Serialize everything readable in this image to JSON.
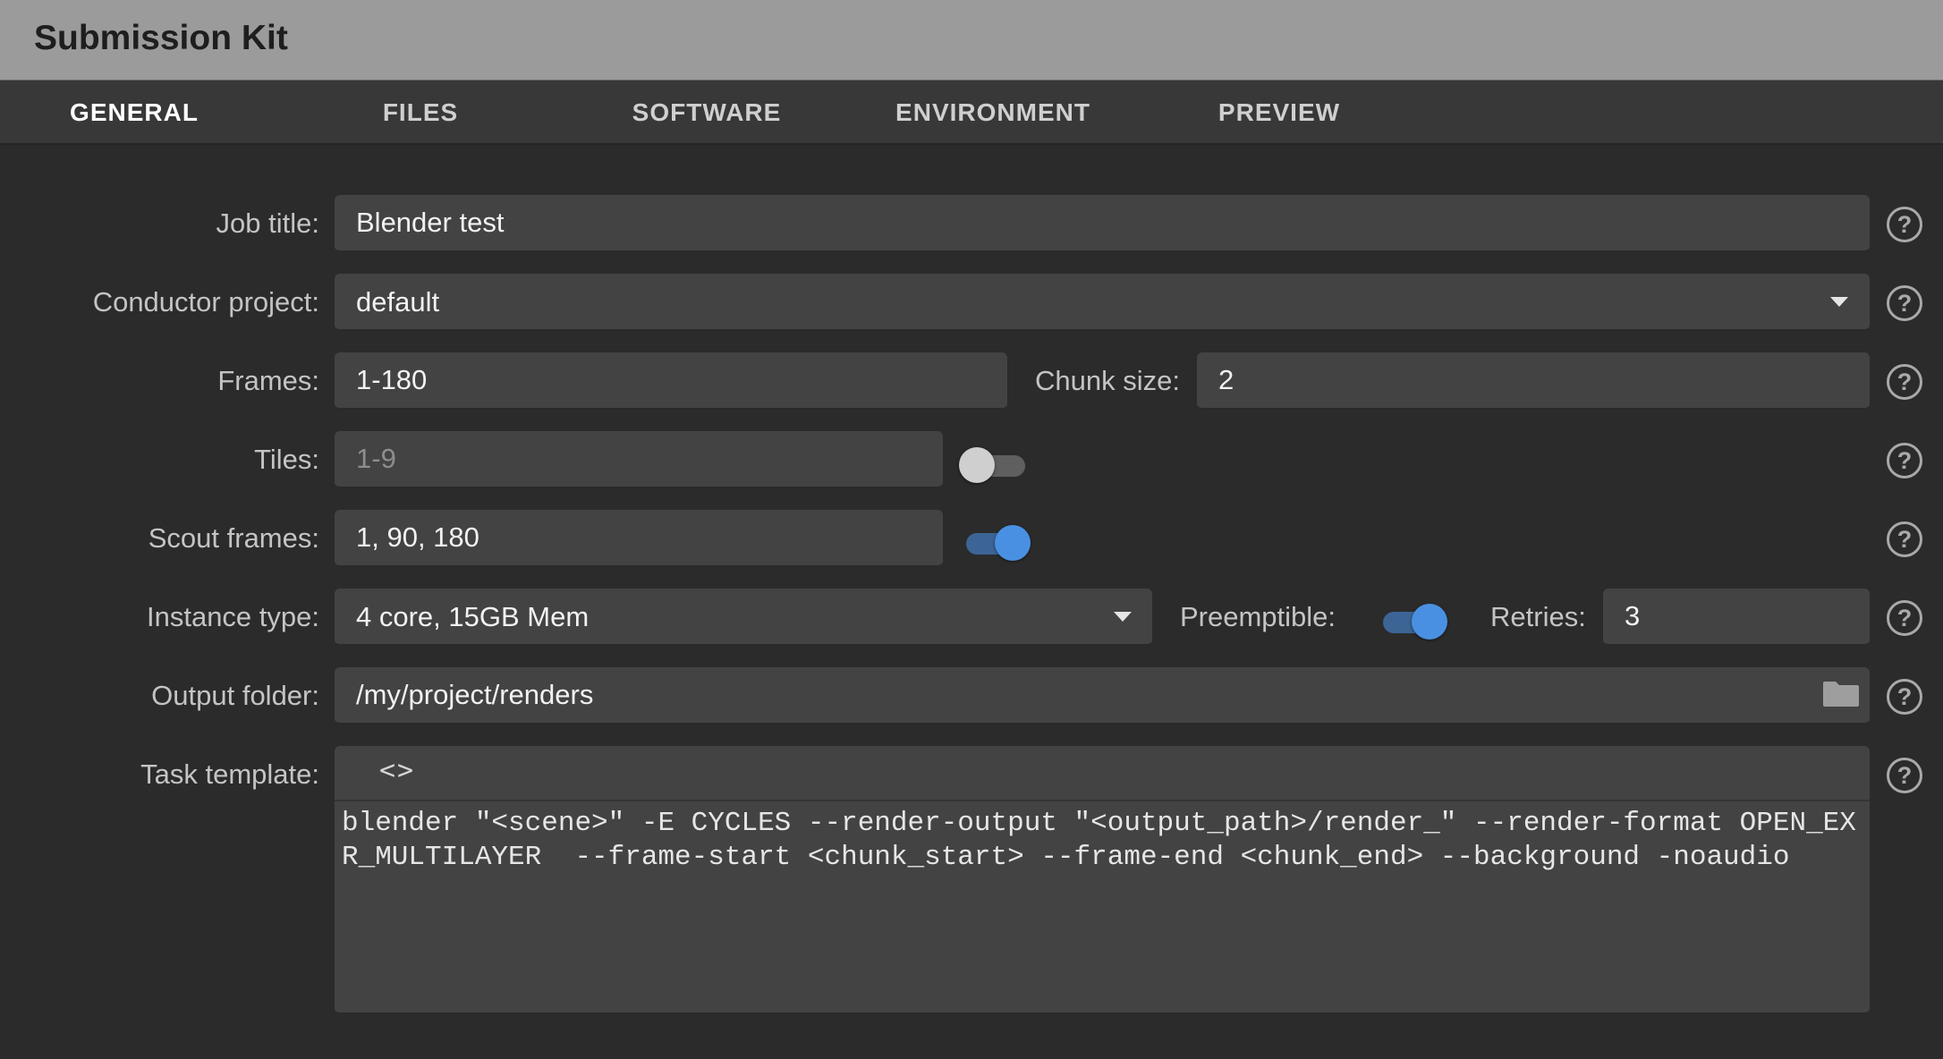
{
  "app": {
    "title": "Submission Kit"
  },
  "tabs": [
    {
      "label": "GENERAL",
      "active": true
    },
    {
      "label": "FILES",
      "active": false
    },
    {
      "label": "SOFTWARE",
      "active": false
    },
    {
      "label": "ENVIRONMENT",
      "active": false
    },
    {
      "label": "PREVIEW",
      "active": false
    }
  ],
  "form": {
    "job_title": {
      "label": "Job title:",
      "value": "Blender test"
    },
    "conductor_project": {
      "label": "Conductor project:",
      "value": "default"
    },
    "frames": {
      "label": "Frames:",
      "value": "1-180"
    },
    "chunk_size": {
      "label": "Chunk size:",
      "value": "2"
    },
    "tiles": {
      "label": "Tiles:",
      "placeholder": "1-9",
      "enabled": false
    },
    "scout_frames": {
      "label": "Scout frames:",
      "value": "1, 90, 180",
      "enabled": true
    },
    "instance_type": {
      "label": "Instance type:",
      "value": "4 core, 15GB Mem"
    },
    "preemptible": {
      "label": "Preemptible:",
      "enabled": true
    },
    "retries": {
      "label": "Retries:",
      "value": "3"
    },
    "output_folder": {
      "label": "Output folder:",
      "value": "/my/project/renders"
    },
    "task_template": {
      "label": "Task template:",
      "toggle_glyph": "<>",
      "value": "blender \"<scene>\" -E CYCLES --render-output \"<output_path>/render_\" --render-format OPEN_EXR_MULTILAYER  --frame-start <chunk_start> --frame-end <chunk_end> --background -noaudio"
    }
  },
  "help_glyph": "?",
  "colors": {
    "accent": "#4a90e2",
    "toggle_on_track": "#3c6596",
    "panel": "#2b2b2b",
    "field": "#434343",
    "titlebar": "#9b9b9b"
  }
}
